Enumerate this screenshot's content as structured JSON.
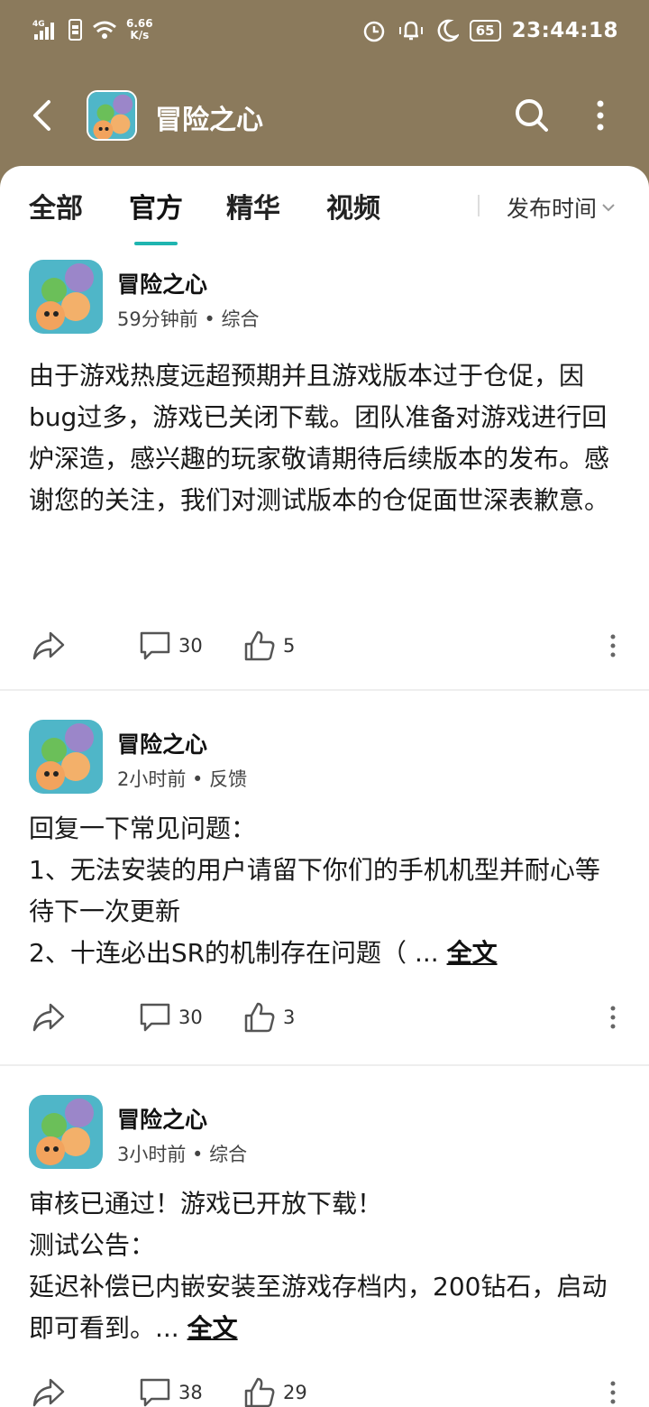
{
  "status_bar": {
    "network": "4G",
    "speed_value": "6.66",
    "speed_unit": "K/s",
    "battery": "65",
    "time": "23:44:18"
  },
  "header": {
    "title": "冒险之心",
    "icons": [
      "back-arrow-icon",
      "search-icon",
      "more-vertical-icon"
    ]
  },
  "tabs": {
    "items": [
      {
        "label": "全部"
      },
      {
        "label": "官方"
      },
      {
        "label": "精华"
      },
      {
        "label": "视频"
      }
    ],
    "active": "官方",
    "sort_label": "发布时间"
  },
  "posts": [
    {
      "author": "冒险之心",
      "meta": "59分钟前 • 综合",
      "body": "由于游戏热度远超预期并且游戏版本过于仓促，因bug过多，游戏已关闭下载。团队准备对游戏进行回炉深造，感兴趣的玩家敬请期待后续版本的发布。感谢您的关注，我们对测试版本的仓促面世深表歉意。",
      "comments": "30",
      "likes": "5"
    },
    {
      "author": "冒险之心",
      "meta": "2小时前 • 反馈",
      "lines": [
        "回复一下常见问题：",
        "1、无法安装的用户请留下你们的手机机型并耐心等待下一次更新",
        "2、十连必出SR的机制存在问题（ ..."
      ],
      "full_text_link": "全文",
      "comments": "30",
      "likes": "3"
    },
    {
      "author": "冒险之心",
      "meta": "3小时前 • 综合",
      "lines": [
        "审核已通过！游戏已开放下载！",
        "测试公告：",
        "延迟补偿已内嵌安装至游戏存档内，200钻石，启动即可看到。..."
      ],
      "full_text_link": "全文",
      "comments": "38",
      "likes": "29"
    }
  ]
}
